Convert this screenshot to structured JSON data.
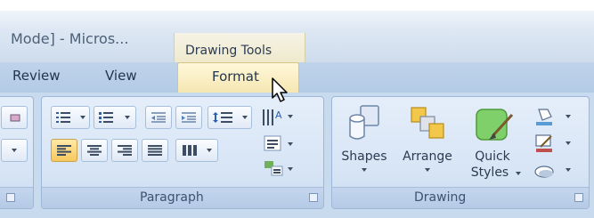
{
  "title_bar": {
    "window_title": "Mode] - Micros...",
    "context_tab_group": "Drawing Tools"
  },
  "tabs": {
    "review": "Review",
    "view": "View",
    "format": "Format",
    "active": "Format"
  },
  "ribbon": {
    "groups": {
      "paragraph": {
        "label": "Paragraph"
      },
      "drawing": {
        "label": "Drawing",
        "buttons": {
          "shapes": "Shapes",
          "arrange": "Arrange",
          "quick_styles_line1": "Quick",
          "quick_styles_line2": "Styles"
        }
      }
    }
  },
  "colors": {
    "ribbon_bg": "#c8daee",
    "active_tab": "#f5e7b2",
    "active_button": "#f7c85d",
    "context_tab": "#ece6c3"
  },
  "icons": [
    "bullets-icon",
    "numbering-icon",
    "decrease-indent-icon",
    "increase-indent-icon",
    "line-spacing-icon",
    "text-direction-icon",
    "align-text-icon",
    "smartart-convert-icon",
    "align-left-icon",
    "center-icon",
    "align-right-icon",
    "justify-icon",
    "columns-icon",
    "shapes-icon",
    "arrange-icon",
    "quick-styles-icon",
    "shape-fill-icon",
    "shape-outline-icon",
    "shape-effects-icon",
    "mouse-cursor-icon"
  ]
}
